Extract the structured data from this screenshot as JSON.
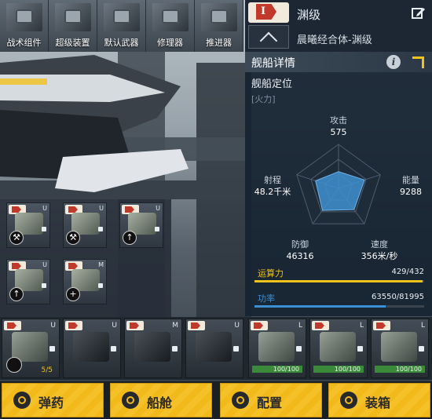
{
  "top_tabs": [
    {
      "label": "战术组件"
    },
    {
      "label": "超级装置"
    },
    {
      "label": "默认武器"
    },
    {
      "label": "修理器"
    },
    {
      "label": "推进器"
    }
  ],
  "header": {
    "tier": "I",
    "ship_class": "渊级",
    "ship_name": "晨曦经合体-渊级"
  },
  "details": {
    "title": "舰船详情",
    "section": "舰船定位",
    "role": "[火力]",
    "stats": {
      "attack": {
        "label": "攻击",
        "value": "575"
      },
      "energy": {
        "label": "能量",
        "value": "9288"
      },
      "speed": {
        "label": "速度",
        "value": "356米/秒"
      },
      "defense": {
        "label": "防御",
        "value": "46316"
      },
      "range": {
        "label": "射程",
        "value": "48.2千米"
      }
    },
    "radar_levels": {
      "attack": 0.38,
      "energy": 0.62,
      "speed": 0.6,
      "defense": 0.62,
      "range": 0.55
    },
    "compute": {
      "label": "运算力",
      "value": "429/432",
      "fraction": 0.993
    },
    "power": {
      "label": "功率",
      "value": "63550/81995",
      "fraction": 0.775
    },
    "colors": {
      "compute_bar": "#f0c21c",
      "power_bar": "#3d8fd4",
      "radar_fill": "#3f8fd0"
    }
  },
  "modules": [
    {
      "tier": "I",
      "slot": "U",
      "action": "wrench"
    },
    {
      "tier": "I",
      "slot": "U",
      "action": "wrench"
    },
    {
      "tier": "I",
      "slot": "U",
      "action": "up"
    },
    {
      "tier": "I",
      "slot": "U",
      "action": "up"
    },
    {
      "tier": "I",
      "slot": "M",
      "action": "plus"
    }
  ],
  "equipment": [
    {
      "tier": "I",
      "slot": "U",
      "count": "5/5"
    },
    {
      "tier": "I",
      "slot": "U",
      "count": ""
    },
    {
      "tier": "I",
      "slot": "M",
      "count": ""
    },
    {
      "tier": "I",
      "slot": "U",
      "count": ""
    },
    {
      "tier": "I",
      "slot": "L",
      "durability": "100/100"
    },
    {
      "tier": "I",
      "slot": "L",
      "durability": "100/100"
    },
    {
      "tier": "I",
      "slot": "L",
      "durability": "100/100"
    }
  ],
  "bottom_nav": [
    {
      "label": "弹药",
      "icon": "ammo-icon"
    },
    {
      "label": "船舱",
      "icon": "cabin-icon"
    },
    {
      "label": "配置",
      "icon": "config-icon"
    },
    {
      "label": "装箱",
      "icon": "crate-icon"
    }
  ]
}
